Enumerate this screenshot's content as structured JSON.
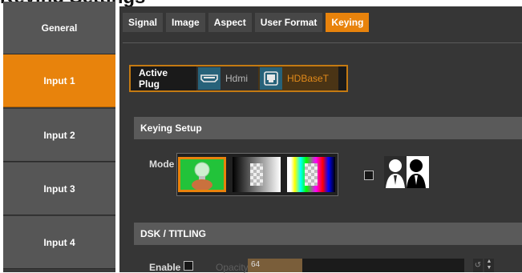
{
  "page_heading": "Keying Settings",
  "sidebar": {
    "items": [
      {
        "label": "General"
      },
      {
        "label": "Input 1"
      },
      {
        "label": "Input 2"
      },
      {
        "label": "Input 3"
      },
      {
        "label": "Input 4"
      }
    ],
    "active_index": 1
  },
  "tabs": [
    {
      "label": "Signal"
    },
    {
      "label": "Image"
    },
    {
      "label": "Aspect"
    },
    {
      "label": "User Format"
    },
    {
      "label": "Keying"
    }
  ],
  "active_tab": "Keying",
  "active_plug": {
    "label": "Active Plug",
    "options": [
      {
        "label": "Hdmi",
        "icon": "hdmi-port-icon",
        "selected": false
      },
      {
        "label": "HDBaseT",
        "icon": "hdbaset-port-icon",
        "selected": true
      }
    ]
  },
  "keying_setup": {
    "title": "Keying Setup",
    "mode_label": "Mode",
    "modes": [
      {
        "icon": "chroma-key-bulb-icon",
        "selected": true
      },
      {
        "icon": "luma-key-gradient-icon",
        "selected": false
      },
      {
        "icon": "color-key-bars-icon",
        "selected": false
      }
    ],
    "silhouette_checkbox_checked": false,
    "silhouette_icon": "silhouette-key-icon"
  },
  "dsk_titling": {
    "title": "DSK / TITLING",
    "enable_label": "Enable",
    "enable_checked": false,
    "opacity_label": "Opacity",
    "opacity_value": "64",
    "opacity_fraction": 0.25
  },
  "colors": {
    "accent": "#e8830c",
    "sidebar_bg": "#565656",
    "panel_bg": "#363636",
    "section_bar": "#5a5a5a",
    "plug_icon_bg": "#27627a",
    "hdbaset_text": "#e28a1a"
  }
}
